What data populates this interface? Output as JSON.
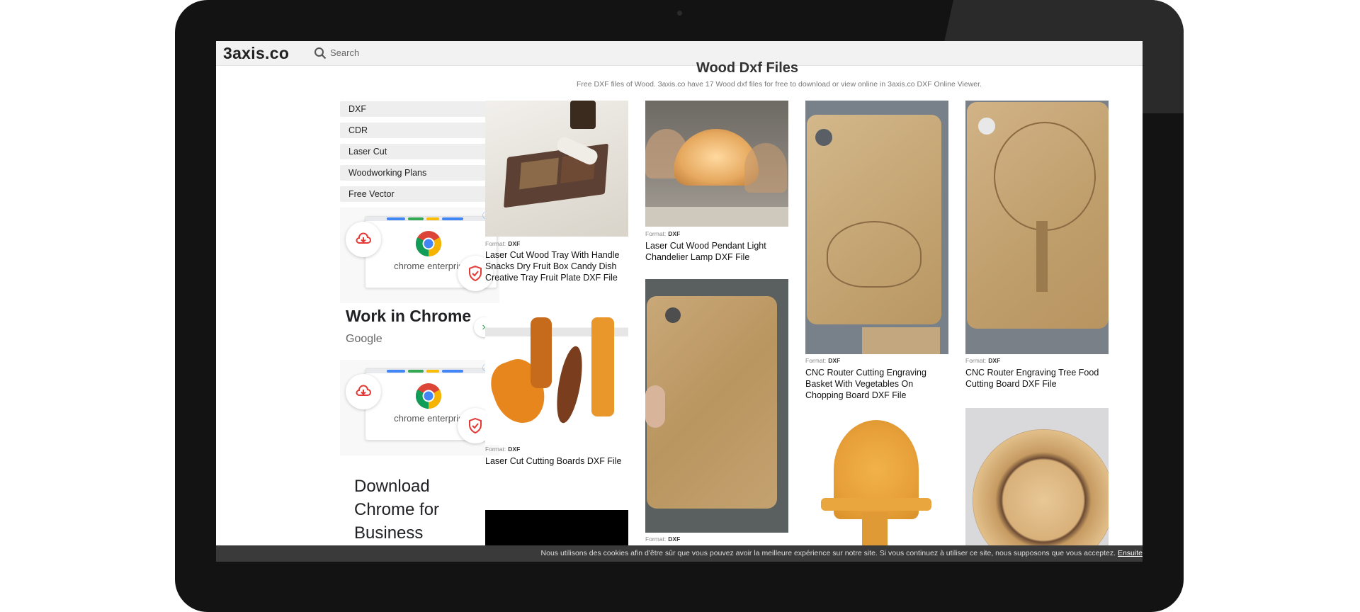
{
  "site": {
    "logo": "3axis.co",
    "search_placeholder": "Search"
  },
  "page": {
    "title": "Wood Dxf Files",
    "subtitle": "Free DXF files of Wood. 3axis.co have 17 Wood dxf files for free to download or view online in 3axis.co DXF Online Viewer."
  },
  "categories": [
    "DXF",
    "CDR",
    "Laser Cut",
    "Woodworking Plans",
    "Free Vector"
  ],
  "ads": [
    {
      "brand": "chrome enterprise",
      "headline": "Work in Chrome",
      "advertiser": "Google"
    },
    {
      "brand": "chrome enterprise",
      "headline": "Download Chrome for Business"
    }
  ],
  "format_label": "Format:",
  "items": [
    {
      "format": "DXF",
      "title": "Laser Cut Wood Tray With Handle Snacks Dry Fruit Box Candy Dish Creative Tray Fruit Plate DXF File"
    },
    {
      "format": "DXF",
      "title": "Laser Cut Cutting Boards DXF File"
    },
    {
      "format": "DXF",
      "title": "Laser Cut Wood Pendant Light Chandelier Lamp DXF File"
    },
    {
      "format": "DXF",
      "title": ""
    },
    {
      "format": "DXF",
      "title": "CNC Router Cutting Engraving Basket With Vegetables On Chopping Board DXF File"
    },
    {
      "format": "DXF",
      "title": "CNC Router Engraving Tree Food Cutting Board DXF File"
    }
  ],
  "cookie": {
    "message": "Nous utilisons des cookies afin d'être sûr que vous pouvez avoir la meilleure expérience sur notre site. Si vous continuez à utiliser ce site, nous supposons que vous acceptez.",
    "link": "Ensuite"
  },
  "colors": {
    "device": "#131313",
    "topbar": "#f2f2f2",
    "cookie_bar": "#3a3a3a",
    "ad_link": "#4a90e2",
    "shield_red": "#e53935"
  }
}
